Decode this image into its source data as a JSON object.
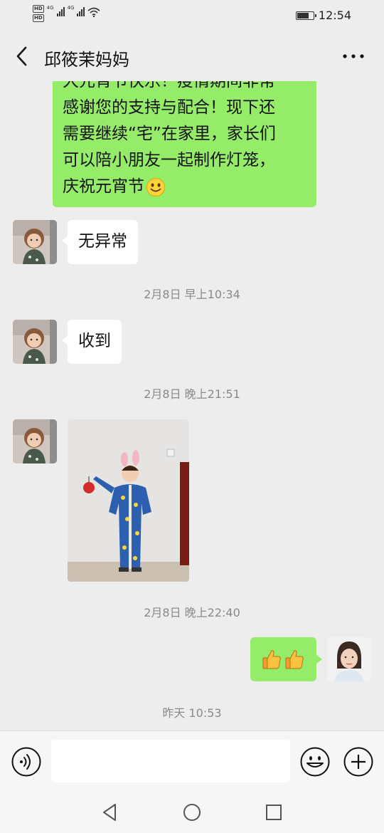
{
  "status_bar": {
    "sim1": "HD",
    "sim2": "HD",
    "network1": "4G",
    "network2": "4G",
    "battery_level": 0.75,
    "time": "12:54"
  },
  "header": {
    "title": "邱筱茉妈妈",
    "back_icon": "chevron-left-icon",
    "more_icon": "more-dots-icon"
  },
  "messages": {
    "m0": {
      "side": "right",
      "lines": [
        "大元宵节快乐！疫情期间非常",
        "感谢您的支持与配合！现下还",
        "需要继续“宅”在家里，家长们",
        "可以陪小朋友一起制作灯笼，",
        "庆祝元宵节"
      ],
      "emoji": "smile-emoji"
    },
    "m1": {
      "side": "left",
      "text": "无异常"
    },
    "t1": "2月8日 早上10:34",
    "m2": {
      "side": "left",
      "text": "收到"
    },
    "t2": "2月8日 晚上21:51",
    "m3": {
      "side": "left",
      "type": "image",
      "image": "child-in-blue-pajamas-photo"
    },
    "t3": "2月8日 晚上22:40",
    "m4": {
      "side": "right",
      "emoji": [
        "thumbs-up-emoji",
        "thumbs-up-emoji"
      ]
    },
    "t4": "昨天 10:53"
  },
  "input_bar": {
    "voice_icon": "voice-icon",
    "text_value": "",
    "emoji_icon": "emoji-icon",
    "plus_icon": "plus-icon"
  },
  "system_nav": {
    "back": "triangle-back-icon",
    "home": "circle-home-icon",
    "recents": "square-recents-icon"
  },
  "colors": {
    "background": "#ededed",
    "sent_bubble": "#95ec69",
    "received_bubble": "#ffffff",
    "timestamp": "#8a8a8a"
  }
}
